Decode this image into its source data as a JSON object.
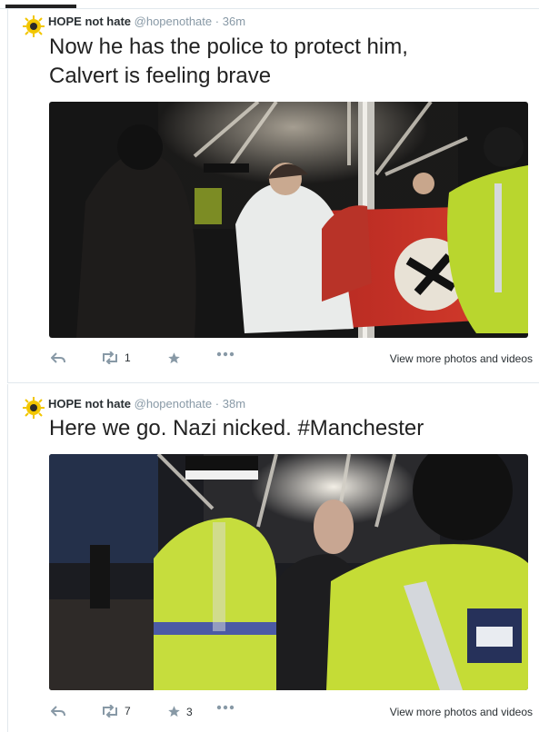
{
  "tweets": [
    {
      "name": "HOPE not hate",
      "handle": "@hopenothate",
      "time": "36m",
      "text_lines": [
        "Now he has the police to protect him,",
        "Calvert is feeling brave"
      ],
      "retweets": "1",
      "favorites": "",
      "more_label": "View more photos and videos"
    },
    {
      "name": "HOPE not hate",
      "handle": "@hopenothate",
      "time": "38m",
      "text_lines": [
        "Here we go. Nazi nicked.  #Manchester"
      ],
      "retweets": "7",
      "favorites": "3",
      "more_label": "View more photos and videos"
    }
  ],
  "colors": {
    "accent": "#8899a6",
    "text": "#222222"
  },
  "icons": [
    "reply-icon",
    "retweet-icon",
    "favorite-icon",
    "more-icon"
  ]
}
